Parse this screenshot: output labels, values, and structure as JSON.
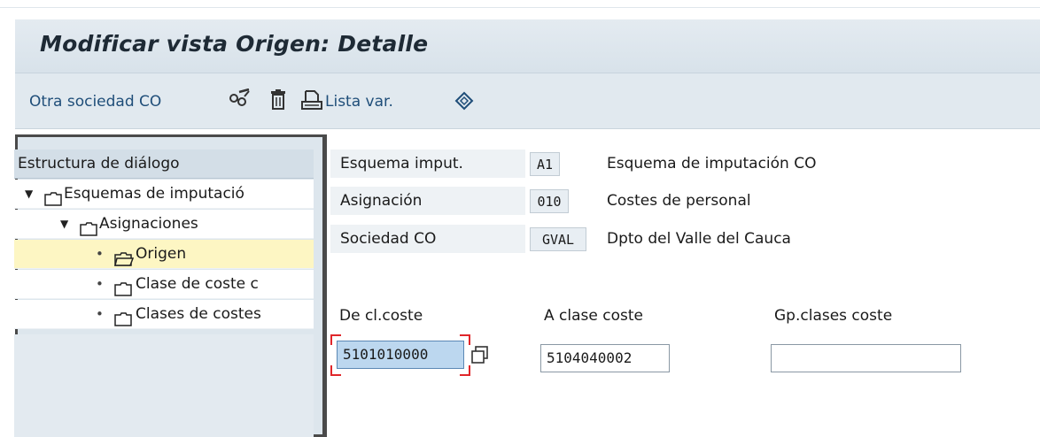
{
  "title": "Modificar vista Origen: Detalle",
  "toolbar": {
    "other_company_label": "Otra sociedad CO",
    "edit_icon": "glasses-pencil-icon",
    "delete_icon": "trash-icon",
    "list_var_label": "Lista var.",
    "list_var_icon": "printer-icon",
    "select_icon": "selection-arrows-icon"
  },
  "tree": {
    "header": "Estructura de diálogo",
    "items": [
      {
        "label": "Esquemas de imputació",
        "level": 1,
        "twisty": "expanded",
        "selected": false
      },
      {
        "label": "Asignaciones",
        "level": 2,
        "twisty": "expanded",
        "selected": false
      },
      {
        "label": "Origen",
        "level": 3,
        "twisty": "leaf",
        "selected": true
      },
      {
        "label": "Clase de coste c",
        "level": 3,
        "twisty": "leaf",
        "selected": false
      },
      {
        "label": "Clases de costes",
        "level": 3,
        "twisty": "leaf",
        "selected": false
      }
    ]
  },
  "keys": [
    {
      "label": "Esquema imput.",
      "value": "A1",
      "description": "Esquema de imputación CO"
    },
    {
      "label": "Asignación",
      "value": "010",
      "description": "Costes de personal"
    },
    {
      "label": "Sociedad CO",
      "value": "GVAL",
      "description": "Dpto del Valle del Cauca"
    }
  ],
  "ranges": {
    "from_label": "De cl.coste",
    "from_value": "5101010000",
    "to_label": "A clase coste",
    "to_value": "5104040002",
    "group_label": "Gp.clases coste",
    "group_value": ""
  },
  "colors": {
    "link": "#1f4e79",
    "selected_row": "#fdf6c3",
    "focus_field": "#bcd7ef",
    "focus_marker": "#e0262a"
  }
}
